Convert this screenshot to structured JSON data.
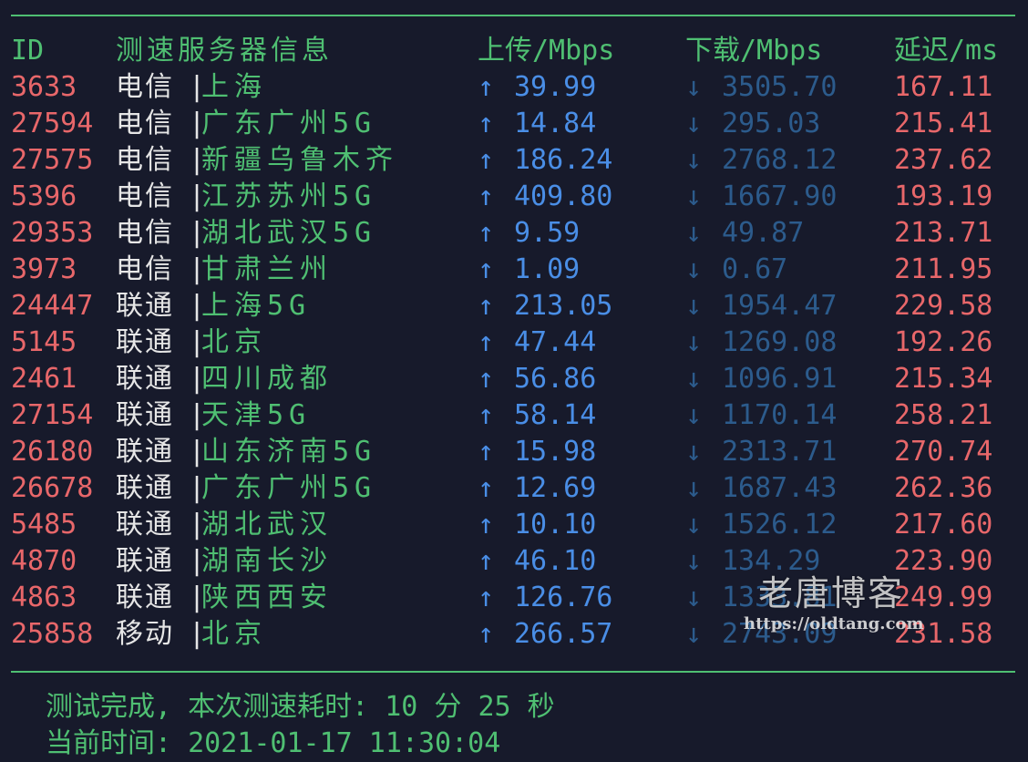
{
  "header": {
    "id": "ID",
    "name": "测速服务器信息",
    "upload": "上传/Mbps",
    "download": "下载/Mbps",
    "latency": "延迟/ms"
  },
  "arrows": {
    "up": "↑",
    "down": "↓"
  },
  "separator": "|",
  "rows": [
    {
      "id": "3633",
      "isp": "电信",
      "city": "上海",
      "up": "39.99",
      "down": "3505.70",
      "latency": "167.11"
    },
    {
      "id": "27594",
      "isp": "电信",
      "city": "广东广州5G",
      "up": "14.84",
      "down": "295.03",
      "latency": "215.41"
    },
    {
      "id": "27575",
      "isp": "电信",
      "city": "新疆乌鲁木齐",
      "up": "186.24",
      "down": "2768.12",
      "latency": "237.62"
    },
    {
      "id": "5396",
      "isp": "电信",
      "city": "江苏苏州5G",
      "up": "409.80",
      "down": "1667.90",
      "latency": "193.19"
    },
    {
      "id": "29353",
      "isp": "电信",
      "city": "湖北武汉5G",
      "up": "9.59",
      "down": "49.87",
      "latency": "213.71"
    },
    {
      "id": "3973",
      "isp": "电信",
      "city": "甘肃兰州",
      "up": "1.09",
      "down": "0.67",
      "latency": "211.95"
    },
    {
      "id": "24447",
      "isp": "联通",
      "city": "上海5G",
      "up": "213.05",
      "down": "1954.47",
      "latency": "229.58"
    },
    {
      "id": "5145",
      "isp": "联通",
      "city": "北京",
      "up": "47.44",
      "down": "1269.08",
      "latency": "192.26"
    },
    {
      "id": "2461",
      "isp": "联通",
      "city": "四川成都",
      "up": "56.86",
      "down": "1096.91",
      "latency": "215.34"
    },
    {
      "id": "27154",
      "isp": "联通",
      "city": "天津5G",
      "up": "58.14",
      "down": "1170.14",
      "latency": "258.21"
    },
    {
      "id": "26180",
      "isp": "联通",
      "city": "山东济南5G",
      "up": "15.98",
      "down": "2313.71",
      "latency": "270.74"
    },
    {
      "id": "26678",
      "isp": "联通",
      "city": "广东广州5G",
      "up": "12.69",
      "down": "1687.43",
      "latency": "262.36"
    },
    {
      "id": "5485",
      "isp": "联通",
      "city": "湖北武汉",
      "up": "10.10",
      "down": "1526.12",
      "latency": "217.60"
    },
    {
      "id": "4870",
      "isp": "联通",
      "city": "湖南长沙",
      "up": "46.10",
      "down": "134.29",
      "latency": "223.90"
    },
    {
      "id": "4863",
      "isp": "联通",
      "city": "陕西西安",
      "up": "126.76",
      "down": "1333.81",
      "latency": "249.99"
    },
    {
      "id": "25858",
      "isp": "移动",
      "city": "北京",
      "up": "266.57",
      "down": "2743.09",
      "latency": "231.58"
    }
  ],
  "watermark": {
    "title": "老唐博客",
    "url": "https://oldtang.com"
  },
  "footer": {
    "summary": "测试完成, 本次测速耗时: 10 分 25 秒",
    "time": "当前时间: 2021-01-17 11:30:04"
  },
  "colors": {
    "background": "#171a2b",
    "green": "#4fbf72",
    "red": "#e8676a",
    "upload_blue": "#4a8ee6",
    "download_blue": "#2c5b8c",
    "text": "#e6e6e6"
  }
}
